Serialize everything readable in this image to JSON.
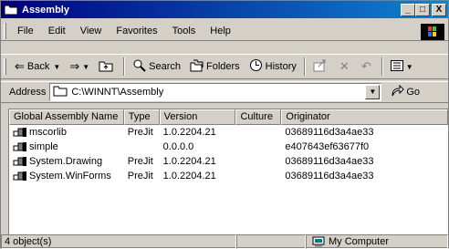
{
  "window": {
    "title": "Assembly"
  },
  "title_buttons": {
    "minimize": "_",
    "maximize": "□",
    "close": "X"
  },
  "menu": {
    "items": [
      "File",
      "Edit",
      "View",
      "Favorites",
      "Tools",
      "Help"
    ]
  },
  "toolbar": {
    "back": "Back",
    "forward_arrow": "⇒",
    "search": "Search",
    "folders": "Folders",
    "history": "History"
  },
  "address": {
    "label": "Address",
    "value": "C:\\WINNT\\Assembly",
    "go": "Go"
  },
  "list": {
    "columns": [
      "Global Assembly Name",
      "Type",
      "Version",
      "Culture",
      "Originator"
    ],
    "rows": [
      {
        "name": "mscorlib",
        "type": "PreJit",
        "version": "1.0.2204.21",
        "culture": "",
        "originator": "03689116d3a4ae33"
      },
      {
        "name": "simple",
        "type": "",
        "version": "0.0.0.0",
        "culture": "",
        "originator": "e407643ef63677f0"
      },
      {
        "name": "System.Drawing",
        "type": "PreJit",
        "version": "1.0.2204.21",
        "culture": "",
        "originator": "03689116d3a4ae33"
      },
      {
        "name": "System.WinForms",
        "type": "PreJit",
        "version": "1.0.2204.21",
        "culture": "",
        "originator": "03689116d3a4ae33"
      }
    ]
  },
  "status": {
    "count": "4 object(s)",
    "zone": "My Computer"
  },
  "icons": [
    "folder-icon",
    "back-arrow-icon",
    "forward-arrow-icon",
    "up-folder-icon",
    "search-icon",
    "folders-icon",
    "history-icon",
    "move-to-icon",
    "delete-icon",
    "undo-icon",
    "views-icon",
    "go-icon",
    "assembly-icon",
    "my-computer-icon",
    "windows-logo-icon"
  ]
}
